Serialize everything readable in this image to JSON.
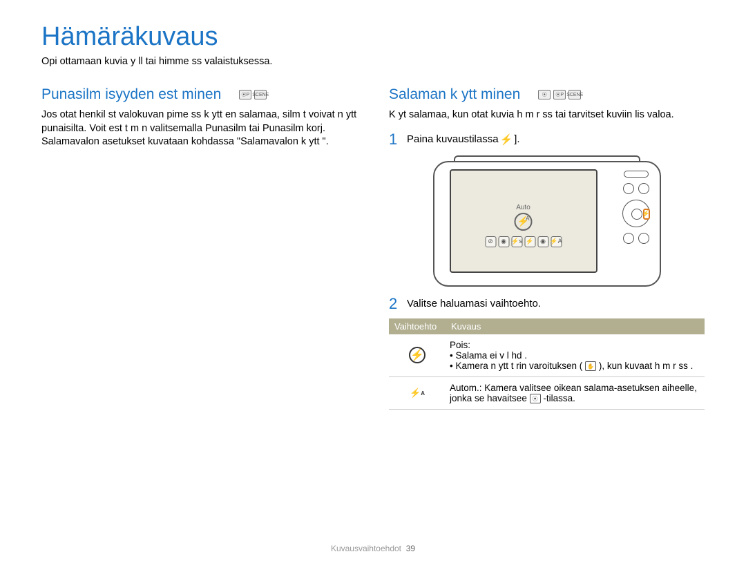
{
  "title": "Hämäräkuvaus",
  "subtitle": "Opi ottamaan kuvia y ll  tai himme ss  valaistuksessa.",
  "left": {
    "heading": "Punasilm isyyden est minen",
    "body": "Jos otat henkil st  valokuvan pime ss  k ytt en salamaa, silm t voivat n ytt   punaisilta. Voit est   t m n valitsemalla Punasilm tai Punasilm korj. Salamavalon asetukset kuvataan kohdassa \"Salamavalon k ytt \"."
  },
  "right": {
    "heading": "Salaman k ytt minen",
    "intro": "K yt  salamaa, kun otat kuvia h m r ss  tai tarvitset kuviin lis   valoa.",
    "steps": {
      "one": {
        "num": "1",
        "text": "Paina kuvaustilassa ",
        "suffix": "]."
      },
      "two": {
        "num": "2",
        "text": "Valitse haluamasi vaihtoehto."
      }
    },
    "screen_label": "Auto",
    "table": {
      "col1": "Vaihtoehto",
      "col2": "Kuvaus",
      "row1": {
        "title": "Pois:",
        "b1": "Salama ei v l hd .",
        "b2a": "Kamera n ytt   t rin varoituksen (",
        "b2b": "), kun kuvaat h m r ss ."
      },
      "row2": {
        "text_a": "Autom.: Kamera valitsee oikean salama-asetuksen aiheelle, jonka se havaitsee",
        "text_b": "-tilassa."
      }
    }
  },
  "footer": {
    "label": "Kuvausvaihtoehdot",
    "page": "39"
  }
}
